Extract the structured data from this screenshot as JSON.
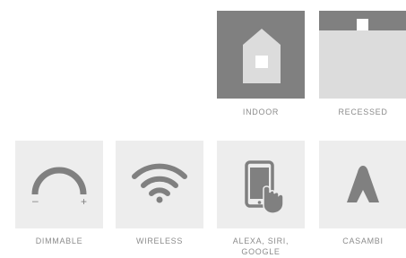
{
  "features": {
    "indoor": {
      "label": "INDOOR",
      "icon": "house-icon"
    },
    "recessed": {
      "label": "RECESSED",
      "icon": "recessed-icon"
    },
    "dimmable": {
      "label": "DIMMABLE",
      "icon": "dimmer-icon",
      "minus": "–",
      "plus": "+"
    },
    "wireless": {
      "label": "WIRELESS",
      "icon": "wifi-icon"
    },
    "voice": {
      "label_line1": "ALEXA, SIRI,",
      "label_line2": "GOOGLE",
      "icon": "smartphone-icon"
    },
    "casambi": {
      "label": "CASAMBI",
      "icon": "casambi-icon"
    }
  },
  "colors": {
    "tile_bg": "#ededed",
    "tile_dark": "#808080",
    "icon": "#808080",
    "label": "#8c8c8c"
  }
}
